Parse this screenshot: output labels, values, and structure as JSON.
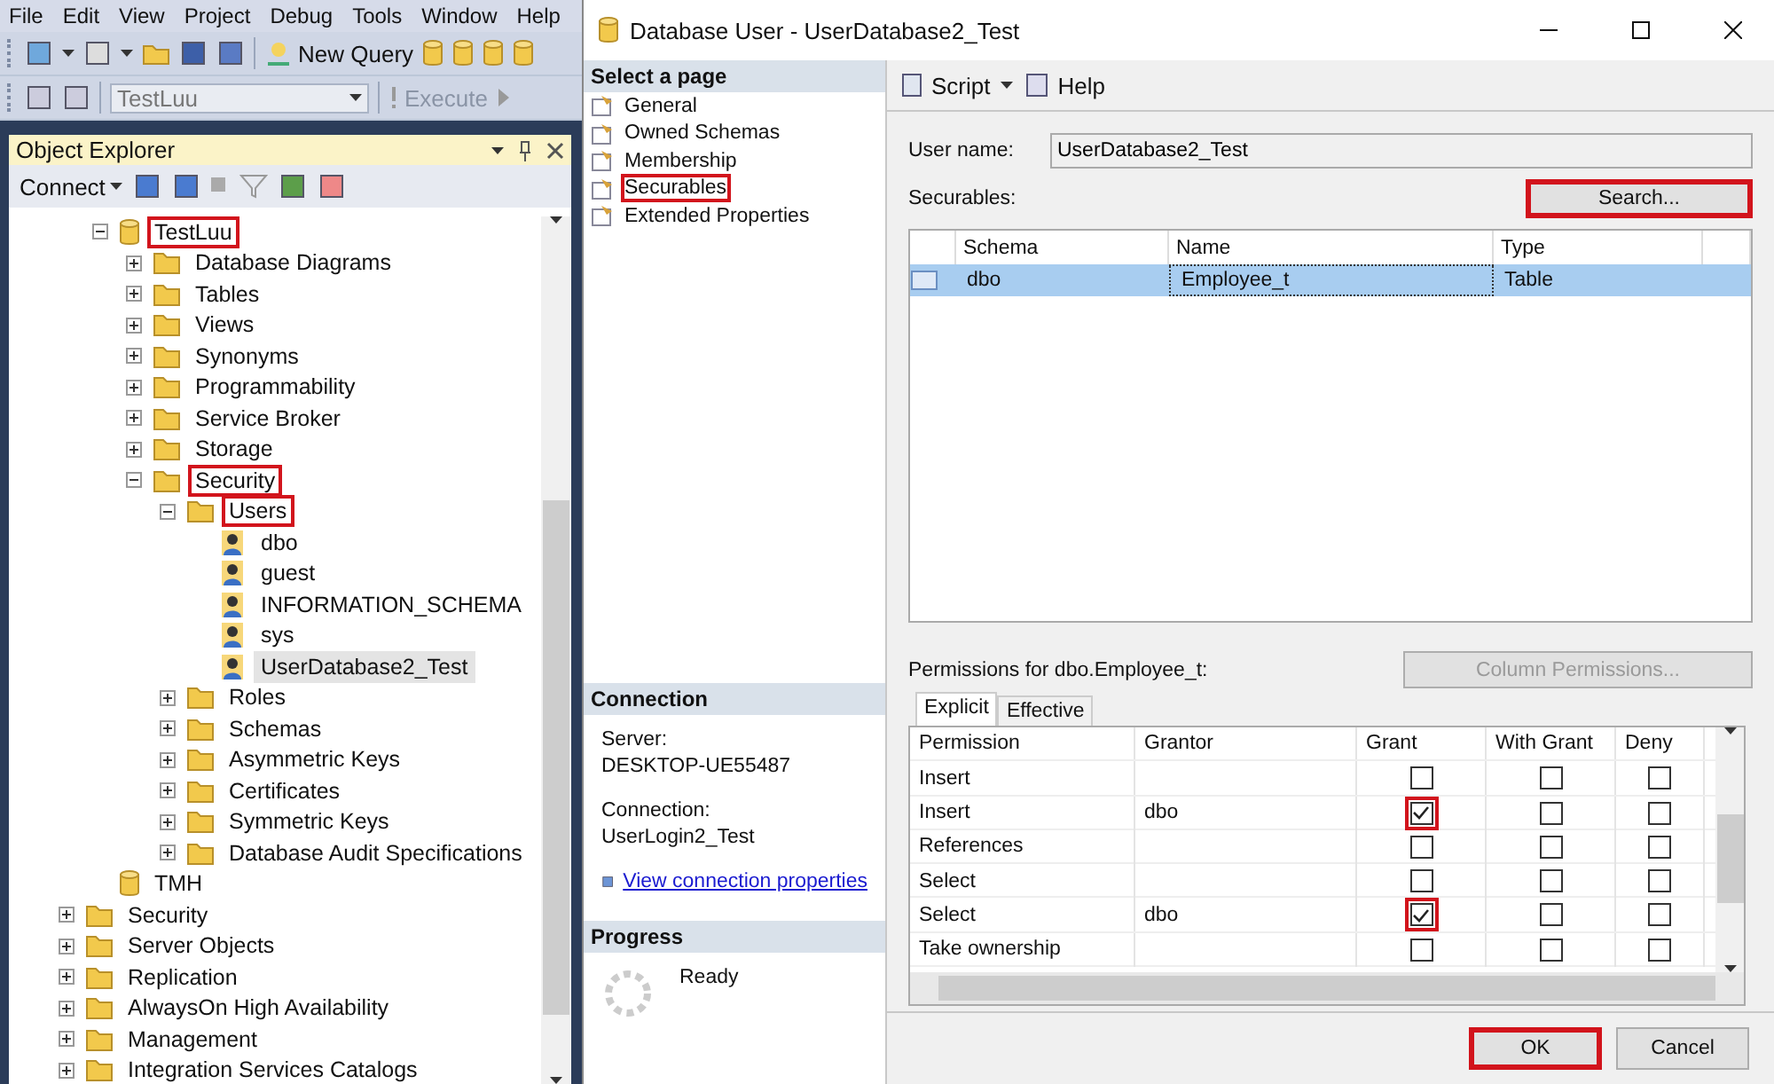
{
  "ssms": {
    "menu": [
      "File",
      "Edit",
      "View",
      "Project",
      "Debug",
      "Tools",
      "Window",
      "Help"
    ],
    "toolbar": {
      "new_query": "New Query",
      "database": "TestLuu",
      "execute": {
        "label": "Execute",
        "disabled": true
      }
    },
    "object_explorer": {
      "title": "Object Explorer",
      "connect": "Connect",
      "tree": [
        {
          "children": [
            {
              "label": "TestLuu",
              "kind": "database",
              "expanded": true,
              "highlighted": true,
              "selected": false,
              "children": [
                {
                  "label": "Database Diagrams",
                  "kind": "folder",
                  "expanded": false,
                  "highlighted": false,
                  "selected": false
                },
                {
                  "label": "Tables",
                  "kind": "folder",
                  "expanded": false,
                  "highlighted": false,
                  "selected": false
                },
                {
                  "label": "Views",
                  "kind": "folder",
                  "expanded": false,
                  "highlighted": false,
                  "selected": false
                },
                {
                  "label": "Synonyms",
                  "kind": "folder",
                  "expanded": false,
                  "highlighted": false,
                  "selected": false
                },
                {
                  "label": "Programmability",
                  "kind": "folder",
                  "expanded": false,
                  "highlighted": false,
                  "selected": false
                },
                {
                  "label": "Service Broker",
                  "kind": "folder",
                  "expanded": false,
                  "highlighted": false,
                  "selected": false
                },
                {
                  "label": "Storage",
                  "kind": "folder",
                  "expanded": false,
                  "highlighted": false,
                  "selected": false
                },
                {
                  "label": "Security",
                  "kind": "folder",
                  "expanded": true,
                  "highlighted": true,
                  "selected": false,
                  "children": [
                    {
                      "label": "Users",
                      "kind": "folder",
                      "expanded": true,
                      "highlighted": true,
                      "selected": false,
                      "children": [
                        {
                          "label": "dbo",
                          "kind": "user",
                          "highlighted": false,
                          "selected": false
                        },
                        {
                          "label": "guest",
                          "kind": "user",
                          "highlighted": false,
                          "selected": false
                        },
                        {
                          "label": "INFORMATION_SCHEMA",
                          "kind": "user",
                          "highlighted": false,
                          "selected": false
                        },
                        {
                          "label": "sys",
                          "kind": "user",
                          "highlighted": false,
                          "selected": false
                        },
                        {
                          "label": "UserDatabase2_Test",
                          "kind": "user",
                          "highlighted": false,
                          "selected": true
                        }
                      ]
                    },
                    {
                      "label": "Roles",
                      "kind": "folder",
                      "expanded": false,
                      "highlighted": false,
                      "selected": false
                    },
                    {
                      "label": "Schemas",
                      "kind": "folder",
                      "expanded": false,
                      "highlighted": false,
                      "selected": false
                    },
                    {
                      "label": "Asymmetric Keys",
                      "kind": "folder",
                      "expanded": false,
                      "highlighted": false,
                      "selected": false
                    },
                    {
                      "label": "Certificates",
                      "kind": "folder",
                      "expanded": false,
                      "highlighted": false,
                      "selected": false
                    },
                    {
                      "label": "Symmetric Keys",
                      "kind": "folder",
                      "expanded": false,
                      "highlighted": false,
                      "selected": false
                    },
                    {
                      "label": "Database Audit Specifications",
                      "kind": "folder",
                      "expanded": false,
                      "highlighted": false,
                      "selected": false
                    }
                  ]
                }
              ]
            },
            {
              "label": "TMH",
              "kind": "database",
              "highlighted": false,
              "selected": false
            }
          ]
        },
        {
          "label": "Security",
          "kind": "folder",
          "expanded": false,
          "highlighted": false,
          "selected": false
        },
        {
          "label": "Server Objects",
          "kind": "folder",
          "expanded": false,
          "highlighted": false,
          "selected": false
        },
        {
          "label": "Replication",
          "kind": "folder",
          "expanded": false,
          "highlighted": false,
          "selected": false
        },
        {
          "label": "AlwaysOn High Availability",
          "kind": "folder",
          "expanded": false,
          "highlighted": false,
          "selected": false
        },
        {
          "label": "Management",
          "kind": "folder",
          "expanded": false,
          "highlighted": false,
          "selected": false
        },
        {
          "label": "Integration Services Catalogs",
          "kind": "folder",
          "expanded": false,
          "highlighted": false,
          "selected": false
        }
      ]
    }
  },
  "dialog": {
    "title": "Database User - UserDatabase2_Test",
    "select_page": {
      "heading": "Select a page",
      "pages": [
        {
          "label": "General",
          "highlighted": false
        },
        {
          "label": "Owned Schemas",
          "highlighted": false
        },
        {
          "label": "Membership",
          "highlighted": false
        },
        {
          "label": "Securables",
          "highlighted": true
        },
        {
          "label": "Extended Properties",
          "highlighted": false
        }
      ]
    },
    "connection": {
      "heading": "Connection",
      "server_label": "Server:",
      "server": "DESKTOP-UE55487",
      "connection_label": "Connection:",
      "connection": "UserLogin2_Test",
      "link": "View connection properties"
    },
    "progress": {
      "heading": "Progress",
      "status": "Ready"
    },
    "toolbar": {
      "script": "Script",
      "help": "Help"
    },
    "user_name": {
      "label": "User name:",
      "value": "UserDatabase2_Test"
    },
    "securables": {
      "label": "Securables:",
      "search": {
        "label": "Search...",
        "highlighted": true
      },
      "columns": [
        "Schema",
        "Name",
        "Type"
      ],
      "rows": [
        {
          "cells": [
            "dbo",
            "Employee_t",
            "Table"
          ],
          "selected": true
        }
      ]
    },
    "permissions": {
      "label": "Permissions for dbo.Employee_t:",
      "column_permissions": {
        "label": "Column Permissions...",
        "disabled": true
      },
      "tabs": [
        {
          "label": "Explicit",
          "selected": true
        },
        {
          "label": "Effective",
          "selected": false
        }
      ],
      "columns": [
        "Permission",
        "Grantor",
        "Grant",
        "With Grant",
        "Deny"
      ],
      "rows": [
        {
          "permission": "Insert",
          "checks": [
            {
              "checked": false,
              "highlighted": false
            },
            {
              "checked": false,
              "highlighted": false
            },
            {
              "checked": false,
              "highlighted": false
            }
          ]
        },
        {
          "permission": "Insert",
          "grantor": "dbo",
          "checks": [
            {
              "checked": true,
              "highlighted": true
            },
            {
              "checked": false,
              "highlighted": false
            },
            {
              "checked": false,
              "highlighted": false
            }
          ]
        },
        {
          "permission": "References",
          "checks": [
            {
              "checked": false,
              "highlighted": false
            },
            {
              "checked": false,
              "highlighted": false
            },
            {
              "checked": false,
              "highlighted": false
            }
          ]
        },
        {
          "permission": "Select",
          "checks": [
            {
              "checked": false,
              "highlighted": false
            },
            {
              "checked": false,
              "highlighted": false
            },
            {
              "checked": false,
              "highlighted": false
            }
          ]
        },
        {
          "permission": "Select",
          "grantor": "dbo",
          "checks": [
            {
              "checked": true,
              "highlighted": true
            },
            {
              "checked": false,
              "highlighted": false
            },
            {
              "checked": false,
              "highlighted": false
            }
          ]
        },
        {
          "permission": "Take ownership",
          "checks": [
            {
              "checked": false,
              "highlighted": false
            },
            {
              "checked": false,
              "highlighted": false
            },
            {
              "checked": false,
              "highlighted": false
            }
          ]
        }
      ]
    },
    "buttons": [
      {
        "label": "OK",
        "highlighted": true,
        "default": true
      },
      {
        "label": "Cancel",
        "highlighted": false,
        "default": false
      }
    ]
  }
}
